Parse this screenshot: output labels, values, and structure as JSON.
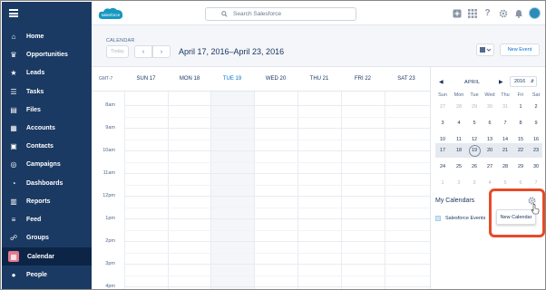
{
  "sidebar": {
    "items": [
      {
        "label": "Home",
        "icon": "home-icon"
      },
      {
        "label": "Opportunities",
        "icon": "crown-icon"
      },
      {
        "label": "Leads",
        "icon": "star-icon"
      },
      {
        "label": "Tasks",
        "icon": "checklist-icon"
      },
      {
        "label": "Files",
        "icon": "file-icon"
      },
      {
        "label": "Accounts",
        "icon": "building-icon"
      },
      {
        "label": "Contacts",
        "icon": "contact-card-icon"
      },
      {
        "label": "Campaigns",
        "icon": "target-icon"
      },
      {
        "label": "Dashboards",
        "icon": "gauge-icon"
      },
      {
        "label": "Reports",
        "icon": "report-icon"
      },
      {
        "label": "Feed",
        "icon": "feed-icon"
      },
      {
        "label": "Groups",
        "icon": "groups-icon"
      },
      {
        "label": "Calendar",
        "icon": "calendar-icon",
        "active": true
      },
      {
        "label": "People",
        "icon": "person-icon"
      }
    ]
  },
  "header": {
    "logo_text": "salesforce",
    "search_placeholder": "Search Salesforce"
  },
  "page": {
    "breadcrumb": "CALENDAR",
    "today_label": "Today",
    "date_range": "April 17, 2016–April 23, 2016",
    "new_event_label": "New Event"
  },
  "week": {
    "timezone": "GMT-7",
    "days": [
      "SUN 17",
      "MON 18",
      "TUE 19",
      "WED 20",
      "THU 21",
      "FRI 22",
      "SAT 23"
    ],
    "today_index": 2,
    "hours": [
      "8am",
      "9am",
      "10am",
      "11am",
      "12pm",
      "1pm",
      "2pm",
      "3pm",
      "4pm"
    ]
  },
  "mini_calendar": {
    "month": "APRIL",
    "year": "2016",
    "weekdays": [
      "Sun",
      "Mon",
      "Tue",
      "Wed",
      "Thu",
      "Fri",
      "Sat"
    ],
    "weeks": [
      [
        "27",
        "28",
        "29",
        "30",
        "31",
        "1",
        "2"
      ],
      [
        "3",
        "4",
        "5",
        "6",
        "7",
        "8",
        "9"
      ],
      [
        "10",
        "11",
        "12",
        "13",
        "14",
        "15",
        "16"
      ],
      [
        "17",
        "18",
        "19",
        "20",
        "21",
        "22",
        "23"
      ],
      [
        "24",
        "25",
        "26",
        "27",
        "28",
        "29",
        "30"
      ],
      [
        "1",
        "2",
        "3",
        "4",
        "5",
        "6",
        "7"
      ]
    ],
    "selected_day": "19"
  },
  "my_calendars": {
    "title": "My Calendars",
    "items": [
      "Salesforce Events"
    ],
    "menu_item": "New Calendar"
  },
  "colors": {
    "sidebar": "#1b3a63",
    "accent": "#0070d2",
    "highlight": "#e84a28",
    "calendar_active": "#e07a8c"
  }
}
